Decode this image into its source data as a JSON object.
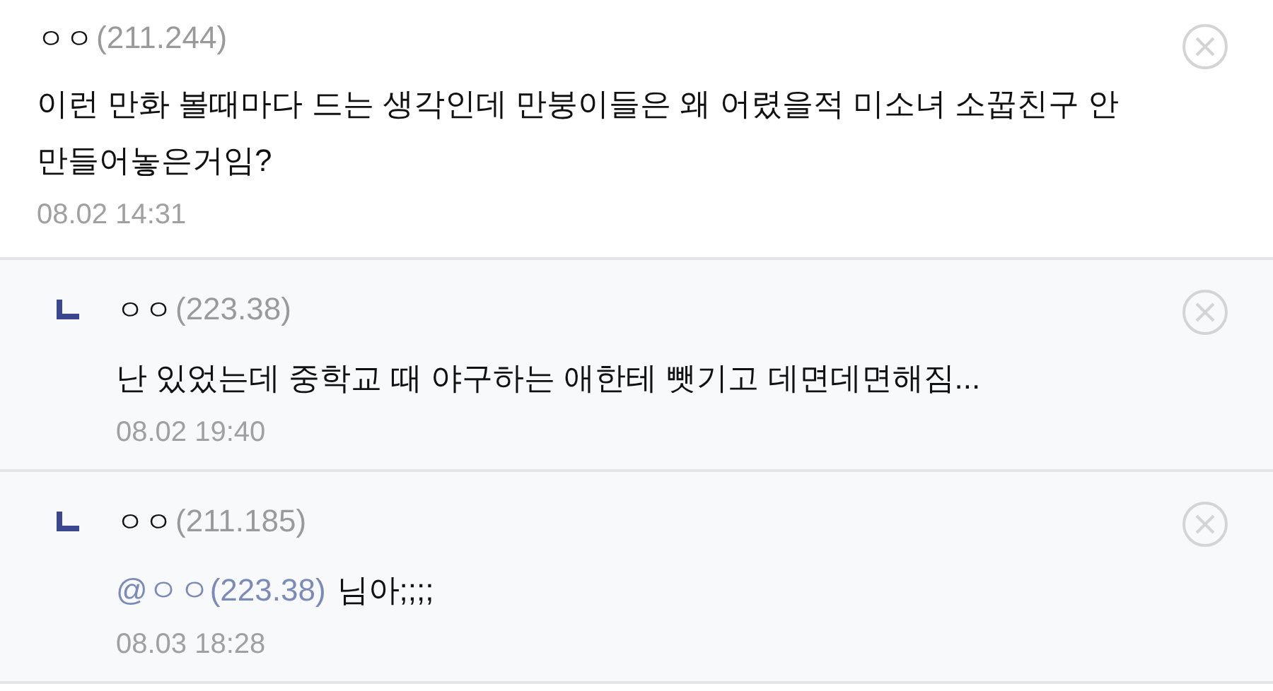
{
  "comments": [
    {
      "kind": "comment",
      "nickname": "ㅇㅇ",
      "ip": "(211.244)",
      "text": "이런 만화 볼때마다 드는 생각인데 만붕이들은 왜 어렸을적 미소녀 소꿉친구 안 만들어놓은거임?",
      "date": "08.02 14:31"
    },
    {
      "kind": "reply",
      "nickname": "ㅇㅇ",
      "ip": "(223.38)",
      "text": "난 있었는데 중학교 때 야구하는 애한테 뺏기고 데면데면해짐...",
      "date": "08.02 19:40"
    },
    {
      "kind": "reply",
      "nickname": "ㅇㅇ",
      "ip": "(211.185)",
      "mention": "@ㅇㅇ(223.38)",
      "text": "님아;;;;",
      "date": "08.03 18:28"
    }
  ]
}
